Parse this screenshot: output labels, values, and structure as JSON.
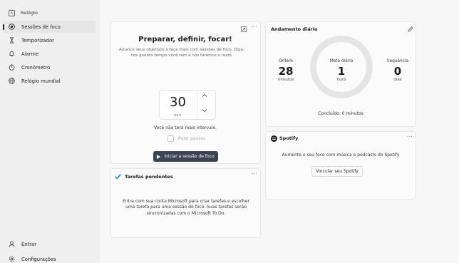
{
  "app": {
    "title": "Relógio"
  },
  "sidebar": {
    "items": [
      {
        "label": "Sessões de foco",
        "icon": "focus-icon",
        "active": true
      },
      {
        "label": "Temporizador",
        "icon": "hourglass-icon"
      },
      {
        "label": "Alarme",
        "icon": "bell-icon"
      },
      {
        "label": "Cronômetro",
        "icon": "stopwatch-icon"
      },
      {
        "label": "Relógio mundial",
        "icon": "globe-icon"
      }
    ],
    "bottom": [
      {
        "label": "Entrar",
        "icon": "person-icon"
      },
      {
        "label": "Configurações",
        "icon": "gear-icon"
      }
    ]
  },
  "focus": {
    "heading": "Preparar, definir, focar!",
    "subtitle": "Alcance seus objetivos e faça mais com sessões de foco. Diga-nos quanto tempo você tem e nós faremos o resto.",
    "minutes": "30",
    "unit": "min",
    "note": "Você não terá mais intervalo.",
    "skip_label": "Pular pausas",
    "start_label": "Iniciar a sessão de foco"
  },
  "tasks": {
    "title": "Tarefas pendentes",
    "body": "Entre com sua conta Microsoft para criar tarefas e escolher uma tarefa para uma sessão de foco. Suas tarefas serão sincronizadas com o Microsoft To Do."
  },
  "progress": {
    "title": "Andamento diário",
    "yesterday": {
      "label": "Ontem",
      "value": "28",
      "unit": "minutos"
    },
    "goal": {
      "label": "Meta diária",
      "value": "1",
      "unit": "hora"
    },
    "streak": {
      "label": "Sequência",
      "value": "0",
      "unit": "dias"
    },
    "completed": "Concluído: 0 minutos"
  },
  "spotify": {
    "title": "Spotify",
    "body": "Aumente o seu foco com música e podcasts do Spotify",
    "link_label": "Vincular seu Spotify"
  },
  "more": "···",
  "window": {
    "minimize": "−",
    "maximize": "▢",
    "close": "✕"
  }
}
